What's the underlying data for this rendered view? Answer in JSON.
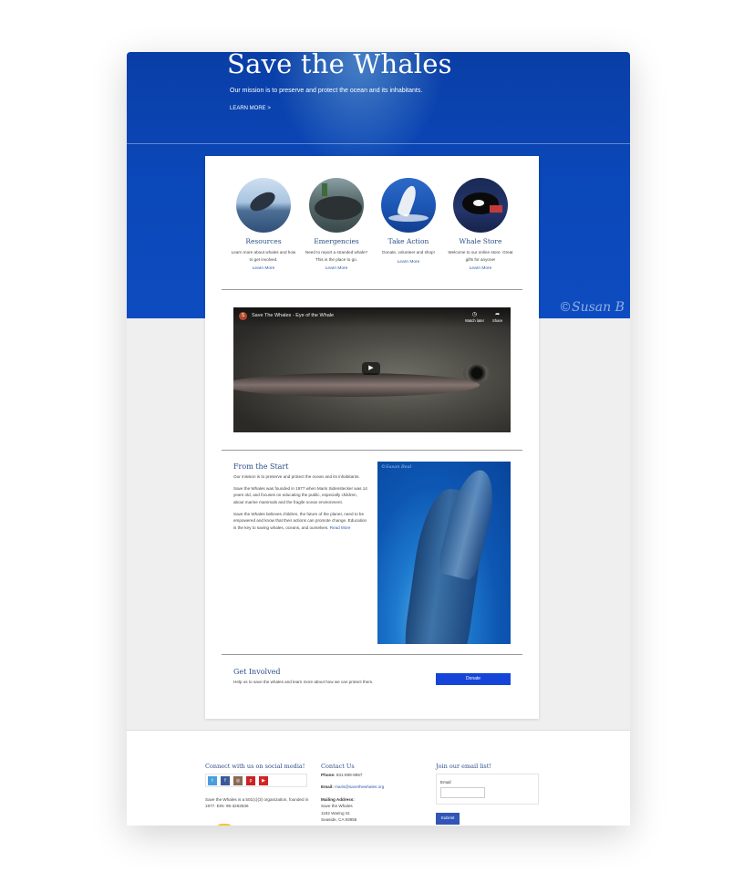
{
  "hero": {
    "title": "Save the Whales",
    "subtitle": "Our mission is to preserve and protect the ocean and its inhabitants.",
    "learn_more": "LEARN MORE >",
    "watermark": "©Susan B"
  },
  "features": [
    {
      "title": "Resources",
      "text": "Learn more about whales and how to get involved.",
      "link": "Learn More"
    },
    {
      "title": "Emergencies",
      "text": "Need to report a stranded whale? This is the place to go.",
      "link": "Learn More"
    },
    {
      "title": "Take Action",
      "text": "Donate, volunteer and shop!",
      "link": "Learn More"
    },
    {
      "title": "Whale Store",
      "text": "Welcome to our online store. Great gifts for anyone!",
      "link": "Learn More"
    }
  ],
  "video": {
    "channel_letter": "S",
    "title": "Save The Whales - Eye of the Whale",
    "watch_later": "Watch later",
    "share": "Share"
  },
  "about": {
    "title": "From the Start",
    "p1": "Our mission is to preserve and protect the ocean and its inhabitants.",
    "p2": "Save the Whales was founded in 1977 when Maris Sidenstecker was 14 years old, and focuses on educating the public, especially children, about marine mammals and the fragile ocean environment.",
    "p3": "Save the Whales believes children, the future of the planet, need to be empowered and know that their actions can promote change. Education is the key to saving whales, oceans, and ourselves.",
    "read_more": "Read More",
    "image_watermark": "©Susan Beal"
  },
  "get_involved": {
    "title": "Get Involved",
    "text": "Help us to save the whales and learn more about how we can protect them.",
    "donate": "Donate"
  },
  "footer": {
    "social_heading": "Connect with us on social media!",
    "social_icons": [
      "twitter-icon",
      "facebook-icon",
      "instagram-icon",
      "pinterest-icon",
      "youtube-icon"
    ],
    "org_line1": "Save the Whales is a 501(c)(3) organization, founded in",
    "org_line2": "1977. EIN: 95-3263536",
    "contact_heading": "Contact Us",
    "phone_label": "Phone:",
    "phone": "831-899-9957",
    "email_label": "Email:",
    "email": "maris@savethewhales.org",
    "mailing_label": "Mailing Address:",
    "address_line1": "Save the Whales",
    "address_line2": "1192 Waring St.",
    "address_line3": "Seaside, CA 93955",
    "email_list_heading": "Join our email list!",
    "email_field_label": "Email",
    "submit": "Submit"
  },
  "colors": {
    "hero_blue": "#0b47b8",
    "heading_blue": "#2a4f86",
    "donate_button": "#1445d8",
    "submit_button": "#3155b8"
  }
}
